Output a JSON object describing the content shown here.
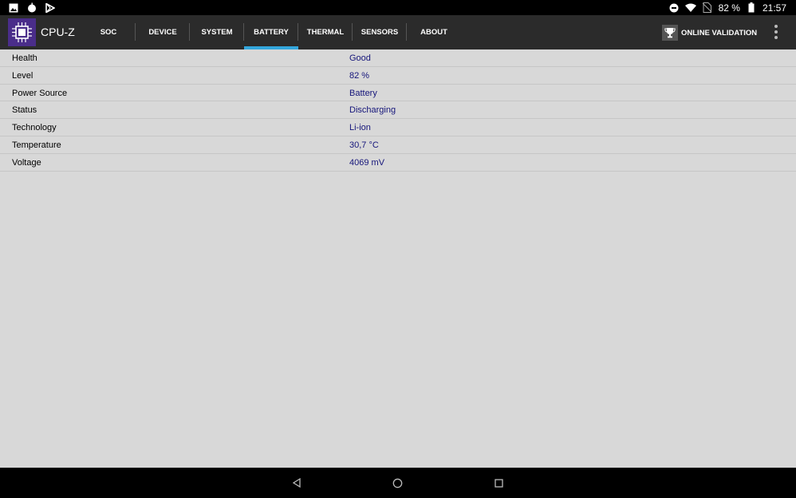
{
  "status_bar": {
    "battery_percent": "82 %",
    "time": "21:57",
    "left_icons": [
      "image-icon",
      "apple-icon",
      "play-store-icon"
    ],
    "right_icons": [
      "do-not-disturb-icon",
      "wifi-icon",
      "no-sim-icon",
      "battery-icon"
    ]
  },
  "app": {
    "title": "CPU-Z",
    "logo_icon": "cpu-chip-icon"
  },
  "tabs": [
    {
      "label": "SOC"
    },
    {
      "label": "DEVICE"
    },
    {
      "label": "SYSTEM"
    },
    {
      "label": "BATTERY",
      "active": true
    },
    {
      "label": "THERMAL"
    },
    {
      "label": "SENSORS"
    },
    {
      "label": "ABOUT"
    }
  ],
  "validation": {
    "label": "ONLINE VALIDATION",
    "icon": "trophy-icon"
  },
  "battery_info": [
    {
      "label": "Health",
      "value": "Good"
    },
    {
      "label": "Level",
      "value": "82 %"
    },
    {
      "label": "Power Source",
      "value": "Battery"
    },
    {
      "label": "Status",
      "value": "Discharging"
    },
    {
      "label": "Technology",
      "value": "Li-ion"
    },
    {
      "label": "Temperature",
      "value": "30,7 °C"
    },
    {
      "label": "Voltage",
      "value": "4069 mV"
    }
  ],
  "colors": {
    "accent": "#33a6dc",
    "value_text": "#15157a",
    "app_bar": "#2b2b2b",
    "logo_bg": "#4a2d8a"
  }
}
